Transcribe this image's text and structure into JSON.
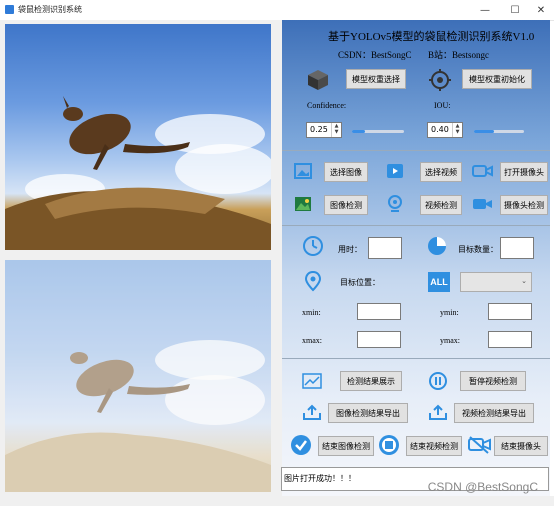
{
  "window": {
    "title": "袋鼠检测识别系统"
  },
  "header": {
    "title": "基于YOLOv5模型的袋鼠检测识别系统V1.0",
    "csdn": "CSDN：BestSongC",
    "bilibili": "B站：Bestsongc"
  },
  "model": {
    "select_label": "模型权重选择",
    "init_label": "模型权重初始化"
  },
  "params": {
    "confidence_label": "Confidence:",
    "confidence_value": "0.25",
    "confidence_level": 0.25,
    "iou_label": "IOU:",
    "iou_value": "0.40",
    "iou_level": 0.4
  },
  "media": {
    "select_image": "选择图像",
    "select_video": "选择视频",
    "open_camera": "打开摄像头",
    "image_detect": "图像检测",
    "video_detect": "视频检测",
    "camera_detect": "摄像头检测"
  },
  "stats": {
    "time_label": "用时：",
    "count_label": "目标数量：",
    "position_label": "目标位置：",
    "all_icon_text": "ALL",
    "xmin_label": "xmin:",
    "ymin_label": "ymin:",
    "xmax_label": "xmax:",
    "ymax_label": "ymax:"
  },
  "actions": {
    "show_result": "检测结果展示",
    "pause_video": "暂停视频检测",
    "export_image": "图像检测结果导出",
    "export_video": "视频检测结果导出",
    "end_image": "结束图像检测",
    "end_video": "结束视频检测",
    "end_camera": "结束摄像头"
  },
  "status": {
    "message": "图片打开成功！！！"
  },
  "watermark": "CSDN @BestSongC",
  "icons": {
    "accent": "#2f8fe0",
    "dark": "#333333"
  }
}
